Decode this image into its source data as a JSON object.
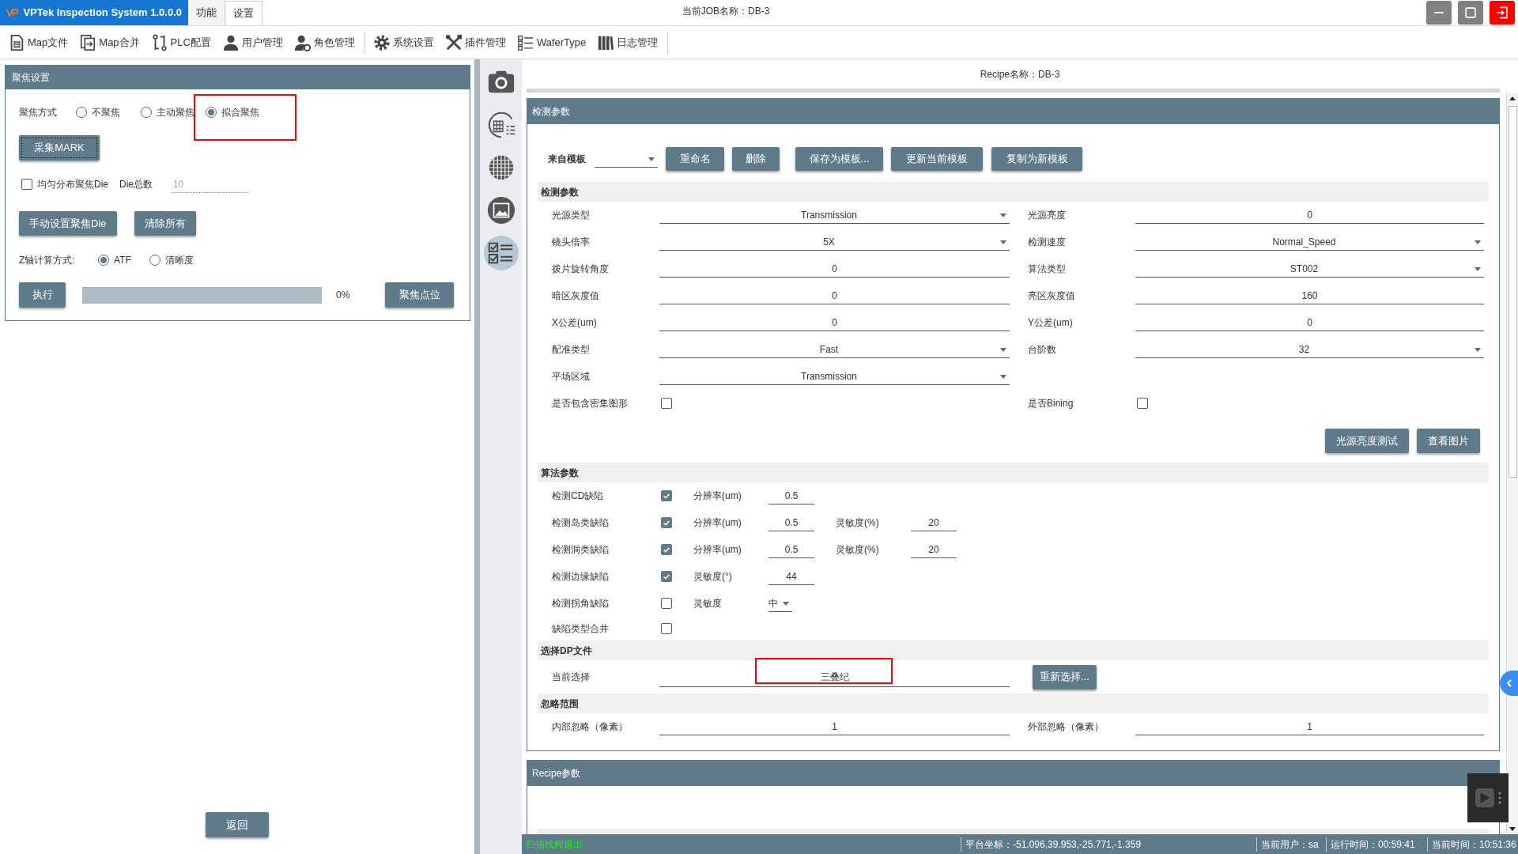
{
  "title_bar": {
    "app_title": "VPTek Inspection System 1.0.0.0",
    "tabs": [
      {
        "label": "功能",
        "selected": false
      },
      {
        "label": "设置",
        "selected": true
      }
    ],
    "job": "当前JOB名称：DB-3",
    "window_buttons": [
      {
        "kind": "minimize"
      },
      {
        "kind": "maximize"
      },
      {
        "kind": "exit"
      }
    ]
  },
  "toolbar": [
    {
      "label": "Map文件",
      "kind": "file",
      "divider_after": false
    },
    {
      "label": "Map合并",
      "kind": "merge",
      "divider_after": false
    },
    {
      "label": "PLC配置",
      "kind": "plc",
      "divider_after": false
    },
    {
      "label": "用户管理",
      "kind": "user",
      "divider_after": false
    },
    {
      "label": "角色管理",
      "kind": "role",
      "divider_after": true
    },
    {
      "label": "系统设置",
      "kind": "gear",
      "divider_after": false
    },
    {
      "label": "插件管理",
      "kind": "tools",
      "divider_after": false
    },
    {
      "label": "WaferType",
      "kind": "list",
      "divider_after": false
    },
    {
      "label": "日志管理",
      "kind": "books",
      "divider_after": true
    }
  ],
  "focus_panel": {
    "title": "聚焦设置",
    "mode_label": "聚焦方式",
    "modes": [
      {
        "label": "不聚焦",
        "selected": false
      },
      {
        "label": "主动聚焦",
        "selected": false
      },
      {
        "label": "拟合聚焦",
        "selected": true
      }
    ],
    "mark_button": "采集MARK",
    "even_checkbox": {
      "label": "均匀分布聚焦Die",
      "checked": false
    },
    "die_count_label": "Die总数",
    "die_count": {
      "value": "10",
      "disabled": true
    },
    "die_buttons": [
      "手动设置聚焦Die",
      "清除所有"
    ],
    "z_label": "Z轴计算方式:",
    "z_modes": [
      {
        "label": "ATF",
        "selected": true
      },
      {
        "label": "清晰度",
        "selected": false
      }
    ],
    "run_button": "执行",
    "progress": {
      "level": 0,
      "reading": "0%"
    },
    "focus_point_button": "聚焦点位"
  },
  "back_button": "返回",
  "side_tools": [
    {
      "kind": "camera",
      "selected": false
    },
    {
      "kind": "wafer-map",
      "selected": false
    },
    {
      "kind": "grid",
      "selected": false
    },
    {
      "kind": "image",
      "selected": false
    },
    {
      "kind": "checklist",
      "selected": true
    }
  ],
  "recipe_name": "Recipe名称：DB-3",
  "inspection_panel": {
    "title": "检测参数",
    "template_label": "来自模板",
    "template_buttons": [
      "重命名",
      "删除",
      "保存为模板...",
      "更新当前模板",
      "复制为新模板"
    ],
    "detect_section": {
      "title": "检测参数",
      "rows": [
        [
          {
            "label": "光源类型",
            "kind": "dropdown",
            "value": "Transmission"
          },
          {
            "label": "光源亮度",
            "kind": "input",
            "value": "0"
          }
        ],
        [
          {
            "label": "镜头倍率",
            "kind": "dropdown",
            "value": "5X"
          },
          {
            "label": "检测速度",
            "kind": "dropdown",
            "value": "Normal_Speed"
          }
        ],
        [
          {
            "label": "拨片旋转角度",
            "kind": "input",
            "value": "0"
          },
          {
            "label": "算法类型",
            "kind": "dropdown",
            "value": "ST002"
          }
        ],
        [
          {
            "label": "暗区灰度值",
            "kind": "input",
            "value": "0"
          },
          {
            "label": "亮区灰度值",
            "kind": "input",
            "value": "160"
          }
        ],
        [
          {
            "label": "X公差(um)",
            "kind": "input",
            "value": "0"
          },
          {
            "label": "Y公差(um)",
            "kind": "input",
            "value": "0"
          }
        ],
        [
          {
            "label": "配准类型",
            "kind": "dropdown",
            "value": "Fast"
          },
          {
            "label": "台阶数",
            "kind": "dropdown",
            "value": "32"
          }
        ],
        [
          {
            "label": "平场区域",
            "kind": "dropdown",
            "value": "Transmission"
          }
        ],
        [
          {
            "label": "是否包含密集图形",
            "kind": "checkbox",
            "checked": false
          },
          {
            "label": "是否Bining",
            "kind": "checkbox",
            "checked": false
          }
        ]
      ],
      "buttons": [
        "光源亮度测试",
        "查看图片"
      ]
    },
    "algorithm_section": {
      "title": "算法参数",
      "rows": [
        {
          "label": "检测CD缺陷",
          "checked": true,
          "params": [
            {
              "label": "分辨率(um)",
              "kind": "input",
              "value": "0.5"
            }
          ]
        },
        {
          "label": "检测岛类缺陷",
          "checked": true,
          "params": [
            {
              "label": "分辨率(um)",
              "kind": "input",
              "value": "0.5"
            },
            {
              "label": "灵敏度(%)",
              "kind": "input",
              "value": "20"
            }
          ]
        },
        {
          "label": "检测洞类缺陷",
          "checked": true,
          "params": [
            {
              "label": "分辨率(um)",
              "kind": "input",
              "value": "0.5"
            },
            {
              "label": "灵敏度(%)",
              "kind": "input",
              "value": "20"
            }
          ]
        },
        {
          "label": "检测边缘缺陷",
          "checked": true,
          "params": [
            {
              "label": "灵敏度(°)",
              "kind": "input",
              "value": "44"
            }
          ]
        },
        {
          "label": "检测拐角缺陷",
          "checked": false,
          "params": [
            {
              "label": "灵敏度",
              "kind": "dropdown",
              "value": "中"
            }
          ]
        },
        {
          "label": "缺陷类型合并",
          "checked": false
        }
      ]
    },
    "dp_section": {
      "title": "选择DP文件",
      "label": "当前选择",
      "value": "三叠纪",
      "button": "重新选择..."
    },
    "ignore_section": {
      "title": "忽略范围",
      "fields": [
        {
          "label": "内部忽略（像素）",
          "value": "1"
        },
        {
          "label": "外部忽略（像素）",
          "value": "1"
        }
      ]
    }
  },
  "recipe_panel": {
    "title": "Recipe参数"
  },
  "status_bar": {
    "message": "扫描线程退出",
    "coordinates": "平台坐标：-51.096,39.953,-25.771,-1.359",
    "user": "当前用户：sa",
    "run_time": "运行时间：00:59:41",
    "current_time": "当前时间：10:51:36"
  }
}
